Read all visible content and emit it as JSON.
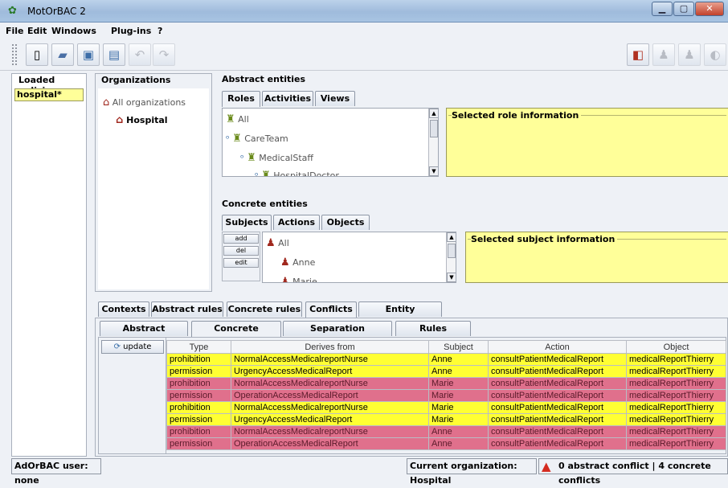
{
  "window": {
    "title": "MotOrBAC 2"
  },
  "menu": [
    "File",
    "Edit",
    "Windows",
    "Plug-ins",
    "?"
  ],
  "left_panel": {
    "title": "Loaded policies",
    "item": "hospital*"
  },
  "organizations": {
    "title": "Organizations",
    "root": "All organizations",
    "child": "Hospital"
  },
  "abstract_entities": {
    "title": "Abstract entities",
    "tabs": [
      "Roles",
      "Activities",
      "Views"
    ],
    "tree": [
      "All",
      "CareTeam",
      "MedicalStaff",
      "HospitalDoctor"
    ],
    "info_title": "Selected role information"
  },
  "concrete_entities": {
    "title": "Concrete entities",
    "tabs": [
      "Subjects",
      "Actions",
      "Objects"
    ],
    "buttons": [
      "add",
      "del",
      "edit"
    ],
    "tree": [
      "All",
      "Anne",
      "Marie"
    ],
    "info_title": "Selected subject information"
  },
  "main_tabs": [
    "Contexts",
    "Abstract rules",
    "Concrete rules",
    "Conflicts",
    "Entity definitions"
  ],
  "sub_tabs": [
    "Abstract conflicts",
    "Concrete conflicts",
    "Separation constraints",
    "Rules priorities"
  ],
  "update_label": "update",
  "table": {
    "headers": [
      "Type",
      "Derives from",
      "Subject",
      "Action",
      "Object"
    ],
    "rows": [
      {
        "type": "prohibition",
        "derives": "NormalAccessMedicalreportNurse",
        "subject": "Anne",
        "action": "consultPatientMedicalReport",
        "object": "medicalReportThierry",
        "color": "#ffff33"
      },
      {
        "type": "permission",
        "derives": "UrgencyAccessMedicalReport",
        "subject": "Anne",
        "action": "consultPatientMedicalReport",
        "object": "medicalReportThierry",
        "color": "#ffff33"
      },
      {
        "type": "prohibition",
        "derives": "NormalAccessMedicalreportNurse",
        "subject": "Marie",
        "action": "consultPatientMedicalReport",
        "object": "medicalReportThierry",
        "color": "#e0708c"
      },
      {
        "type": "permission",
        "derives": "OperationAccessMedicalReport",
        "subject": "Marie",
        "action": "consultPatientMedicalReport",
        "object": "medicalReportThierry",
        "color": "#e0708c"
      },
      {
        "type": "prohibition",
        "derives": "NormalAccessMedicalreportNurse",
        "subject": "Marie",
        "action": "consultPatientMedicalReport",
        "object": "medicalReportThierry",
        "color": "#ffff33"
      },
      {
        "type": "permission",
        "derives": "UrgencyAccessMedicalReport",
        "subject": "Marie",
        "action": "consultPatientMedicalReport",
        "object": "medicalReportThierry",
        "color": "#ffff33"
      },
      {
        "type": "prohibition",
        "derives": "NormalAccessMedicalreportNurse",
        "subject": "Anne",
        "action": "consultPatientMedicalReport",
        "object": "medicalReportThierry",
        "color": "#e0708c"
      },
      {
        "type": "permission",
        "derives": "OperationAccessMedicalReport",
        "subject": "Anne",
        "action": "consultPatientMedicalReport",
        "object": "medicalReportThierry",
        "color": "#e0708c"
      }
    ]
  },
  "status": {
    "user": "AdOrBAC user: none",
    "org": "Current organization: Hospital",
    "conflicts": "0 abstract conflict | 4 concrete conflicts"
  },
  "colors": {
    "accent_yellow": "#ffff99",
    "conflict_yellow": "#ffff33",
    "conflict_pink": "#e0708c",
    "warning_red": "#d42a1e"
  }
}
